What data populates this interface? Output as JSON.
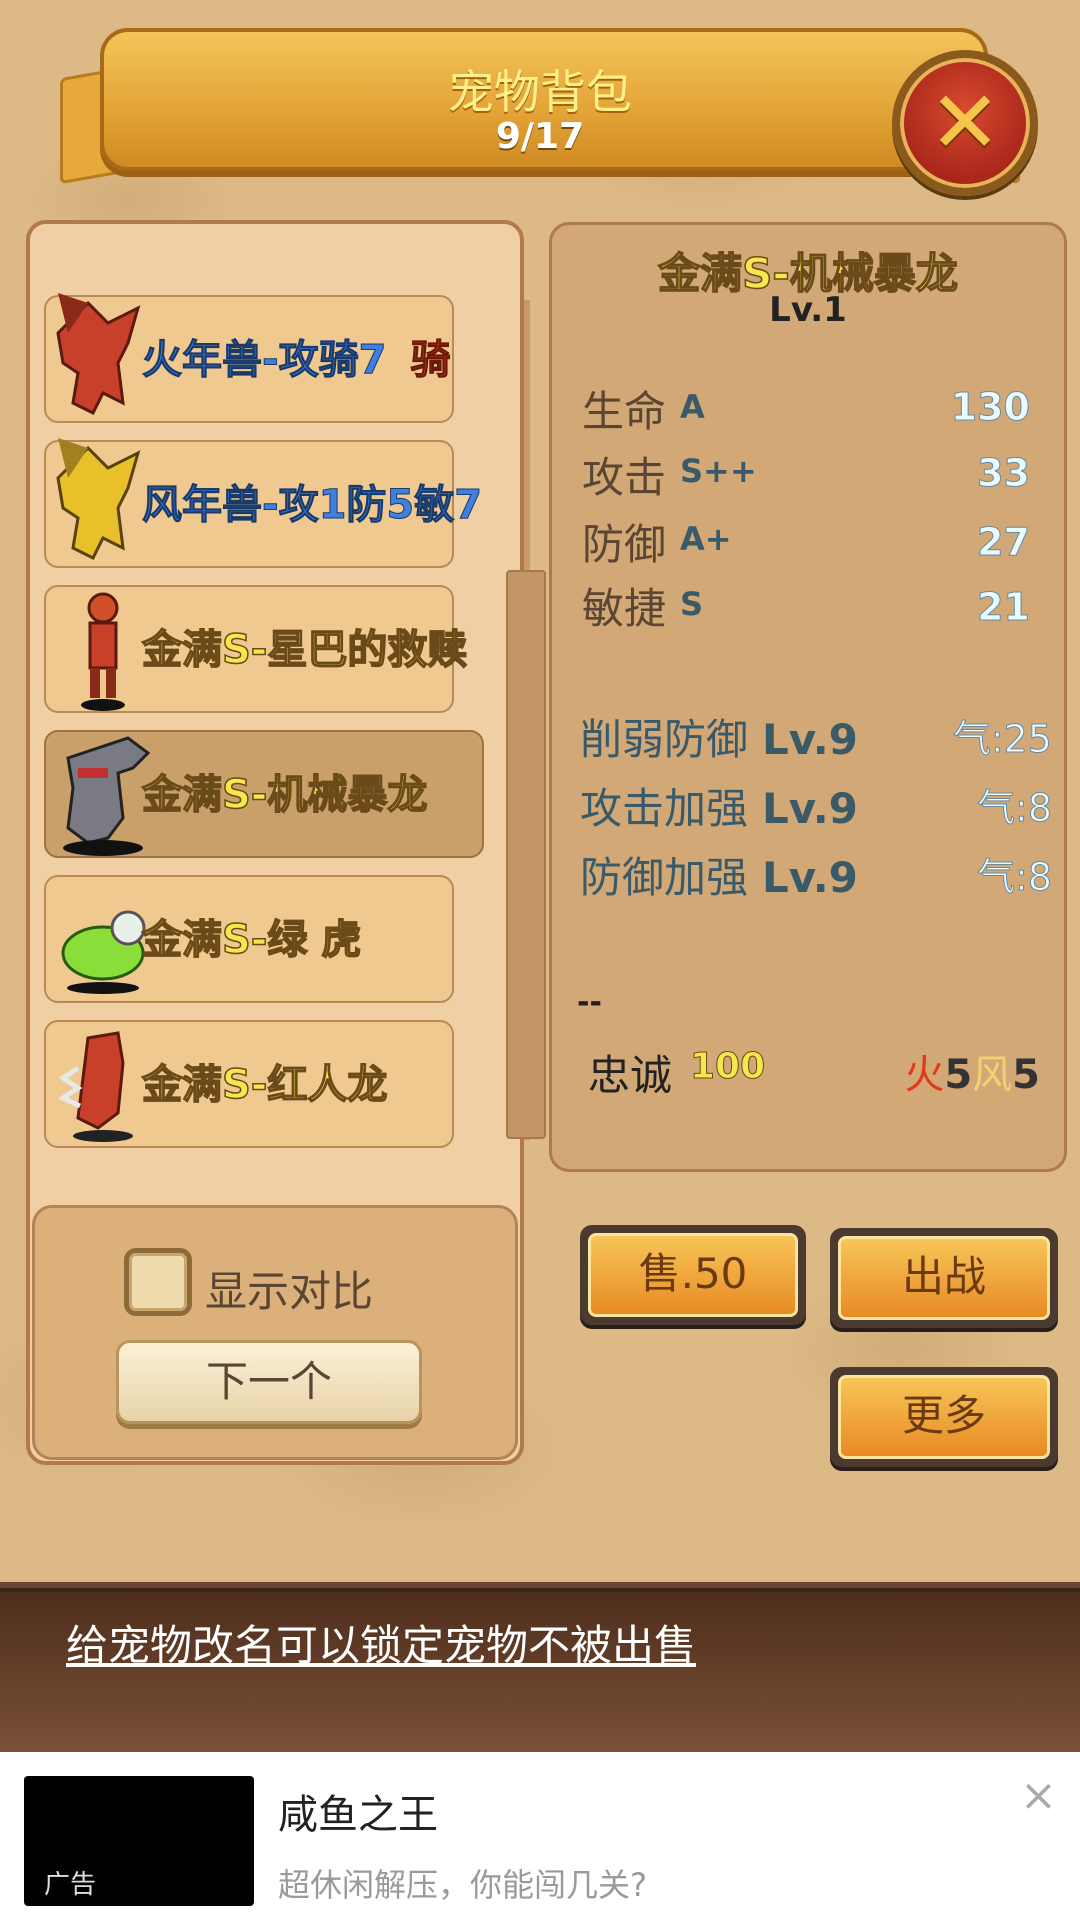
{
  "header": {
    "title": "宠物背包",
    "count": "9/17"
  },
  "pets": [
    {
      "name": "火年兽-攻骑7",
      "tag": "骑",
      "color": "blue",
      "sprite": "red-dragon-icon"
    },
    {
      "name": "风年兽-攻1防5敏7",
      "tag": "",
      "color": "blue",
      "sprite": "yellow-dragon-icon"
    },
    {
      "name": "金满S-星巴的救赎",
      "tag": "",
      "color": "gold",
      "sprite": "red-warrior-icon"
    },
    {
      "name": "金满S-机械暴龙",
      "tag": "",
      "color": "gold",
      "sprite": "mech-trex-icon",
      "selected": true
    },
    {
      "name": "金满S-绿 虎",
      "tag": "",
      "color": "gold",
      "sprite": "green-tiger-icon"
    },
    {
      "name": "金满S-红人龙",
      "tag": "",
      "color": "gold",
      "sprite": "red-dragonman-icon"
    }
  ],
  "compare": {
    "label": "显示对比",
    "checked": false,
    "next_label": "下一个"
  },
  "detail": {
    "name": "金满S-机械暴龙",
    "level": "Lv.1",
    "stats": [
      {
        "label": "生命",
        "grade": "A",
        "value": "130"
      },
      {
        "label": "攻击",
        "grade": "S++",
        "value": "33"
      },
      {
        "label": "防御",
        "grade": "A+",
        "value": "27"
      },
      {
        "label": "敏捷",
        "grade": "S",
        "value": "21"
      }
    ],
    "skills": [
      {
        "name": "削弱防御",
        "level": "Lv.9",
        "qi": "气:25"
      },
      {
        "name": "攻击加强",
        "level": "Lv.9",
        "qi": "气:8"
      },
      {
        "name": "防御加强",
        "level": "Lv.9",
        "qi": "气:8"
      }
    ],
    "dash": "--",
    "loyalty_label": "忠诚",
    "loyalty_value": "100",
    "elements": {
      "fire_label": "火",
      "fire_value": "5",
      "wind_label": "风",
      "wind_value": "5"
    }
  },
  "actions": {
    "sell": "售.50",
    "fight": "出战",
    "more": "更多"
  },
  "tip": "给宠物改名可以锁定宠物不被出售",
  "ad": {
    "title": "咸鱼之王",
    "subtitle": "超休闲解压，你能闯几关?",
    "badge": "广告",
    "close": "×"
  },
  "colors": {
    "gold_text": "#f5e84c",
    "blue_text": "#3f7fe0",
    "panel": "#d1a876",
    "button": "#e88a24"
  }
}
